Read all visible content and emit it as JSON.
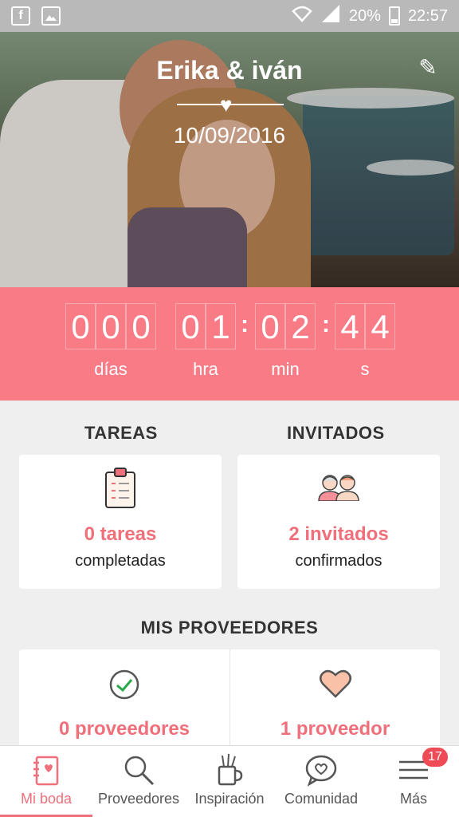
{
  "status_bar": {
    "battery": "20%",
    "time": "22:57"
  },
  "header": {
    "couple_names": "Erika & iván",
    "wedding_date": "10/09/2016"
  },
  "countdown": {
    "days": "000",
    "hours": "01",
    "minutes": "02",
    "seconds": "44",
    "labels": {
      "days": "días",
      "hours": "hra",
      "minutes": "min",
      "seconds": "s"
    }
  },
  "tasks": {
    "title": "TAREAS",
    "count": "0 tareas",
    "status": "completadas"
  },
  "guests": {
    "title": "INVITADOS",
    "count": "2 invitados",
    "status": "confirmados"
  },
  "vendors": {
    "title": "MIS PROVEEDORES",
    "left_count": "0 proveedores",
    "right_count": "1 proveedor"
  },
  "bottom_nav": {
    "items": [
      {
        "label": "Mi boda",
        "icon": "notebook-icon",
        "active": true
      },
      {
        "label": "Proveedores",
        "icon": "search-icon"
      },
      {
        "label": "Inspiración",
        "icon": "cup-icon"
      },
      {
        "label": "Comunidad",
        "icon": "chat-heart-icon"
      },
      {
        "label": "Más",
        "icon": "menu-icon",
        "badge": "17"
      }
    ]
  },
  "colors": {
    "accent": "#ef6f7b",
    "countdown_bg": "#f97b86",
    "status_bar": "#b9b9b9"
  }
}
